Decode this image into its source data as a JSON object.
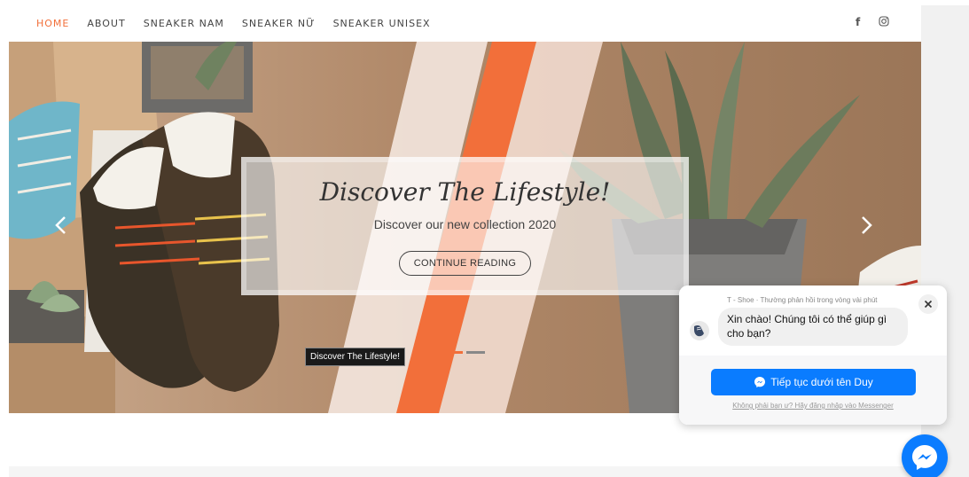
{
  "nav": {
    "items": [
      {
        "label": "HOME",
        "active": true
      },
      {
        "label": "ABOUT"
      },
      {
        "label": "SNEAKER NAM"
      },
      {
        "label": "SNEAKER NỮ"
      },
      {
        "label": "SNEAKER UNISEX"
      }
    ],
    "social": {
      "facebook_glyph": "f",
      "facebook_icon": "facebook-icon",
      "instagram_icon": "instagram-icon"
    }
  },
  "hero": {
    "title": "Discover The Lifestyle!",
    "subtitle": "Discover our new collection 2020",
    "button_label": "CONTINUE READING",
    "tooltip": "Discover The Lifestyle!",
    "slides_total": 2,
    "active_slide": 1,
    "accent_color": "#f26f3a"
  },
  "chat": {
    "status": "T - Shoe · Thường phản hồi trong vòng vài phút",
    "greeting": "Xin chào! Chúng tôi có thể giúp gì cho bạn?",
    "cta_label": "Tiếp tục dưới tên Duy",
    "switch_link": "Không phải bạn ư? Hãy đăng nhập vào Messenger",
    "brand_color": "#0a7cff"
  }
}
